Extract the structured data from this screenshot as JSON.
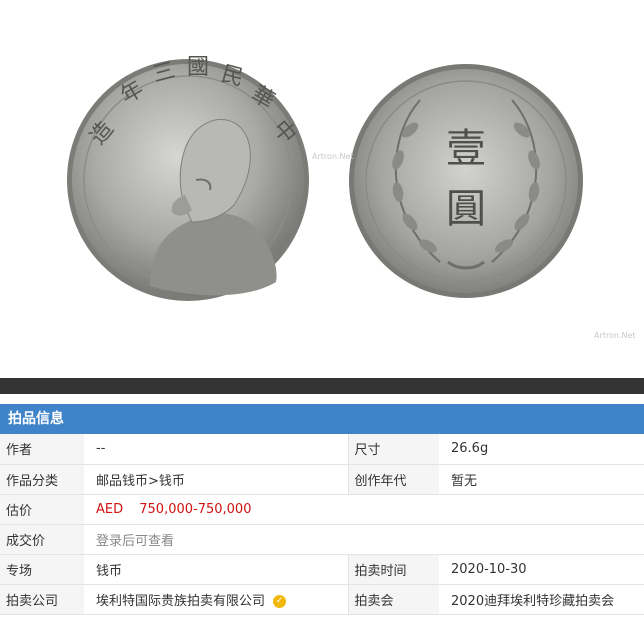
{
  "photo": {
    "obverse_characters": [
      "中",
      "華",
      "民",
      "國",
      "三",
      "年",
      "造"
    ],
    "reverse_characters": [
      "壹",
      "圓"
    ],
    "watermark": "Artron.Net"
  },
  "section_title": "拍品信息",
  "rows": [
    {
      "label": "作者",
      "value": "--",
      "label2": "尺寸",
      "value2": "26.6g"
    },
    {
      "label": "作品分类",
      "value": "邮品钱币>钱币",
      "label2": "创作年代",
      "value2": "暂无"
    },
    {
      "label": "估价",
      "currency": "AED",
      "price": "750,000-750,000"
    },
    {
      "label": "成交价",
      "value": "登录后可查看"
    },
    {
      "label": "专场",
      "value": "钱币",
      "label2": "拍卖时间",
      "value2": "2020-10-30"
    },
    {
      "label": "拍卖公司",
      "value": "埃利特国际贵族拍卖有限公司",
      "label2": "拍卖会",
      "value2": "2020迪拜埃利特珍藏拍卖会"
    }
  ],
  "colors": {
    "header_bg": "#3f84c9",
    "price": "#d01212",
    "verify_badge": "#f0b90b"
  },
  "icons": {
    "verify": "verified-badge-icon"
  }
}
